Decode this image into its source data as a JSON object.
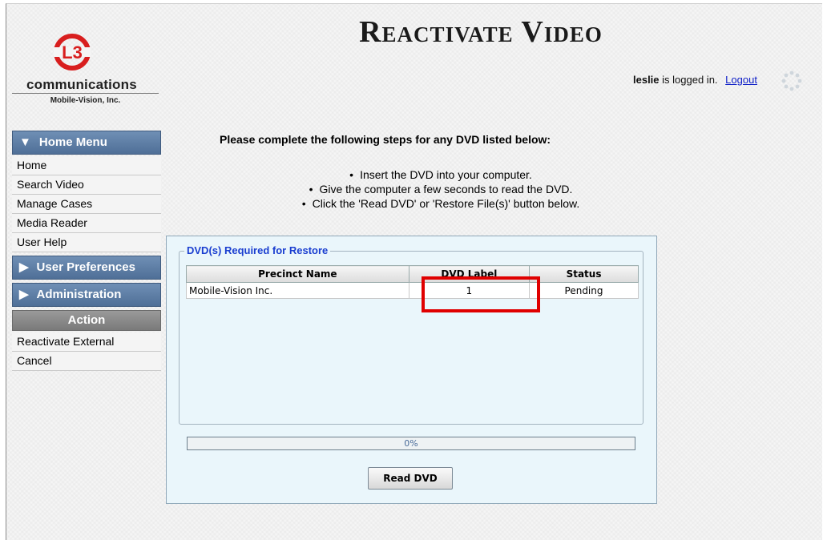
{
  "logo": {
    "mark_text": "L3",
    "company": "communications",
    "subtitle": "Mobile-Vision, Inc."
  },
  "title": "Reactivate Video",
  "user": {
    "name": "leslie",
    "status_text": "is logged in.",
    "logout_label": "Logout"
  },
  "sidebar": {
    "home_menu": {
      "label": "Home Menu",
      "items": [
        {
          "label": "Home"
        },
        {
          "label": "Search Video"
        },
        {
          "label": "Manage Cases"
        },
        {
          "label": "Media Reader"
        },
        {
          "label": "User Help"
        }
      ]
    },
    "user_prefs": {
      "label": "User Preferences"
    },
    "administration": {
      "label": "Administration"
    },
    "action": {
      "label": "Action",
      "items": [
        {
          "label": "Reactivate External"
        },
        {
          "label": "Cancel"
        }
      ]
    }
  },
  "instructions": {
    "title": "Please complete the following steps for any DVD listed below:",
    "steps": [
      "Insert the DVD into your computer.",
      "Give the computer a few seconds to read the DVD.",
      "Click the 'Read DVD' or 'Restore File(s)' button below."
    ]
  },
  "panel": {
    "legend": "DVD(s) Required for Restore",
    "columns": [
      "Precinct Name",
      "DVD Label",
      "Status"
    ],
    "rows": [
      {
        "precinct": "Mobile-Vision Inc.",
        "label": "1",
        "status": "Pending"
      }
    ],
    "progress_text": "0%",
    "progress_value": 0,
    "read_button": "Read DVD"
  },
  "colors": {
    "highlight": "#e00000",
    "menu_header": "#5f7fa6",
    "link": "#1020c8",
    "logo_red": "#d81e1e"
  }
}
